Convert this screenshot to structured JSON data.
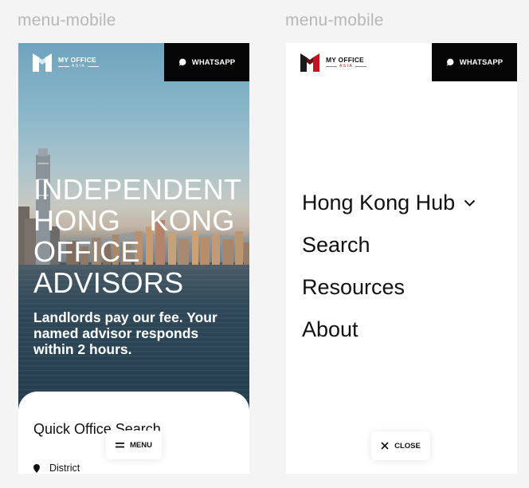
{
  "frames": {
    "left_label": "menu-mobile",
    "right_label": "menu-mobile"
  },
  "brand": {
    "name": "MY OFFICE",
    "sub": "ASIA",
    "accent": "#c0151f"
  },
  "header": {
    "whatsapp_label": "WHATSAPP"
  },
  "hero": {
    "headline": [
      "INDEPENDENT",
      "HONG KONG",
      "OFFICE",
      "ADVISORS"
    ],
    "subhead": "Landlords pay our fee. Your named advisor responds within 2 hours."
  },
  "search": {
    "title": "Quick Office Search",
    "district_label": "District"
  },
  "menu_button": {
    "label": "MENU"
  },
  "close_button": {
    "label": "CLOSE"
  },
  "menu": {
    "items": [
      {
        "label": "Hong Kong Hub",
        "icon": "chevron-down-icon"
      },
      {
        "label": "Search"
      },
      {
        "label": "Resources"
      },
      {
        "label": "About"
      }
    ]
  },
  "colors": {
    "background": "#f4f4f4",
    "whatsapp_bg": "#050505",
    "label_grey": "#b7b7b7"
  }
}
